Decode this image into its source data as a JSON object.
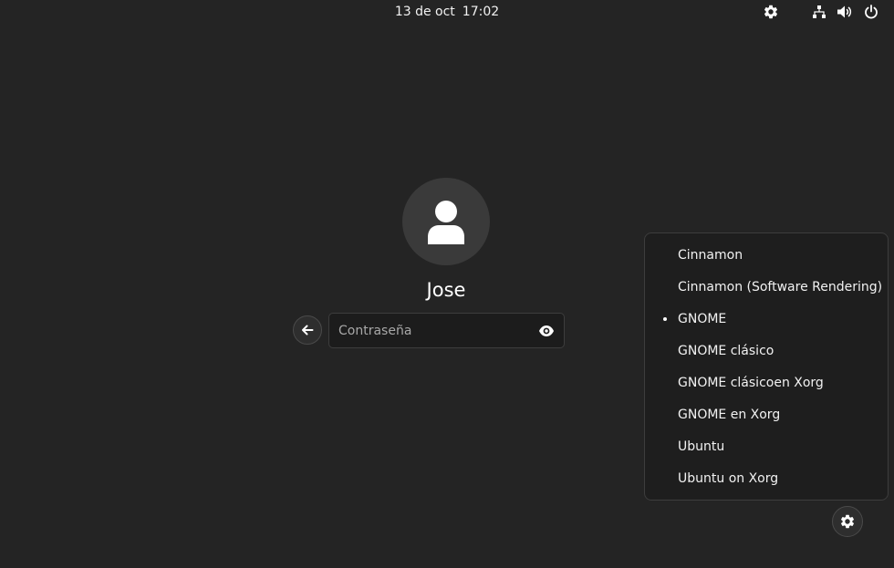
{
  "top_bar": {
    "date": "13 de oct",
    "time": "17:02",
    "icons": [
      "accessibility-gear-icon",
      "network-icon",
      "volume-icon",
      "power-icon"
    ]
  },
  "login": {
    "username": "Jose",
    "avatar_icon": "user-icon",
    "back_icon": "arrow-left-icon",
    "password_placeholder": "Contraseña",
    "password_value": "",
    "reveal_icon": "eye-icon"
  },
  "session_menu": {
    "items": [
      {
        "label": "Cinnamon",
        "selected": false
      },
      {
        "label": "Cinnamon (Software Rendering)",
        "selected": false
      },
      {
        "label": "GNOME",
        "selected": true
      },
      {
        "label": "GNOME clásico",
        "selected": false
      },
      {
        "label": "GNOME clásicoen Xorg",
        "selected": false
      },
      {
        "label": "GNOME en Xorg",
        "selected": false
      },
      {
        "label": "Ubuntu",
        "selected": false
      },
      {
        "label": "Ubuntu on Xorg",
        "selected": false
      }
    ],
    "button_icon": "gear-icon"
  },
  "colors": {
    "background": "#242424",
    "menu_background": "#1e1e1e",
    "text": "#f2f2f2"
  }
}
